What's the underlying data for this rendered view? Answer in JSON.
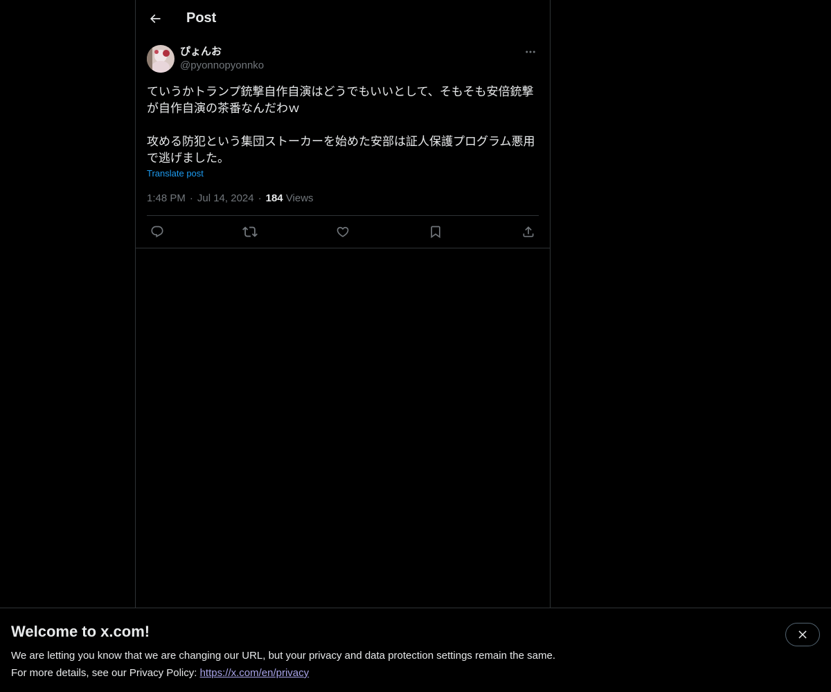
{
  "header": {
    "title": "Post"
  },
  "post": {
    "author": {
      "display_name": "ぴょんお",
      "handle": "@pyonnopyonnko"
    },
    "body_paragraph_1": "ていうかトランプ銃撃自作自演はどうでもいいとして、そもそも安倍銃撃が自作自演の茶番なんだわｗ",
    "body_paragraph_2": "攻める防犯という集団ストーカーを始めた安部は証人保護プログラム悪用で逃げました。",
    "translate_label": "Translate post",
    "time": "1:48 PM",
    "date": "Jul 14, 2024",
    "views_count": "184",
    "views_label": "Views",
    "separator": "·"
  },
  "actions": {
    "icons": [
      "reply-icon",
      "repost-icon",
      "like-icon",
      "bookmark-icon",
      "share-icon"
    ]
  },
  "banner": {
    "title": "Welcome to x.com!",
    "line1": "We are letting you know that we are changing our URL, but your privacy and data protection settings remain the same.",
    "line2_prefix": "For more details, see our Privacy Policy: ",
    "link_text": "https://x.com/en/privacy"
  },
  "colors": {
    "background": "#000000",
    "text": "#e7e9ea",
    "muted": "#71767b",
    "link": "#1d9bf0",
    "border": "#2f3336"
  }
}
